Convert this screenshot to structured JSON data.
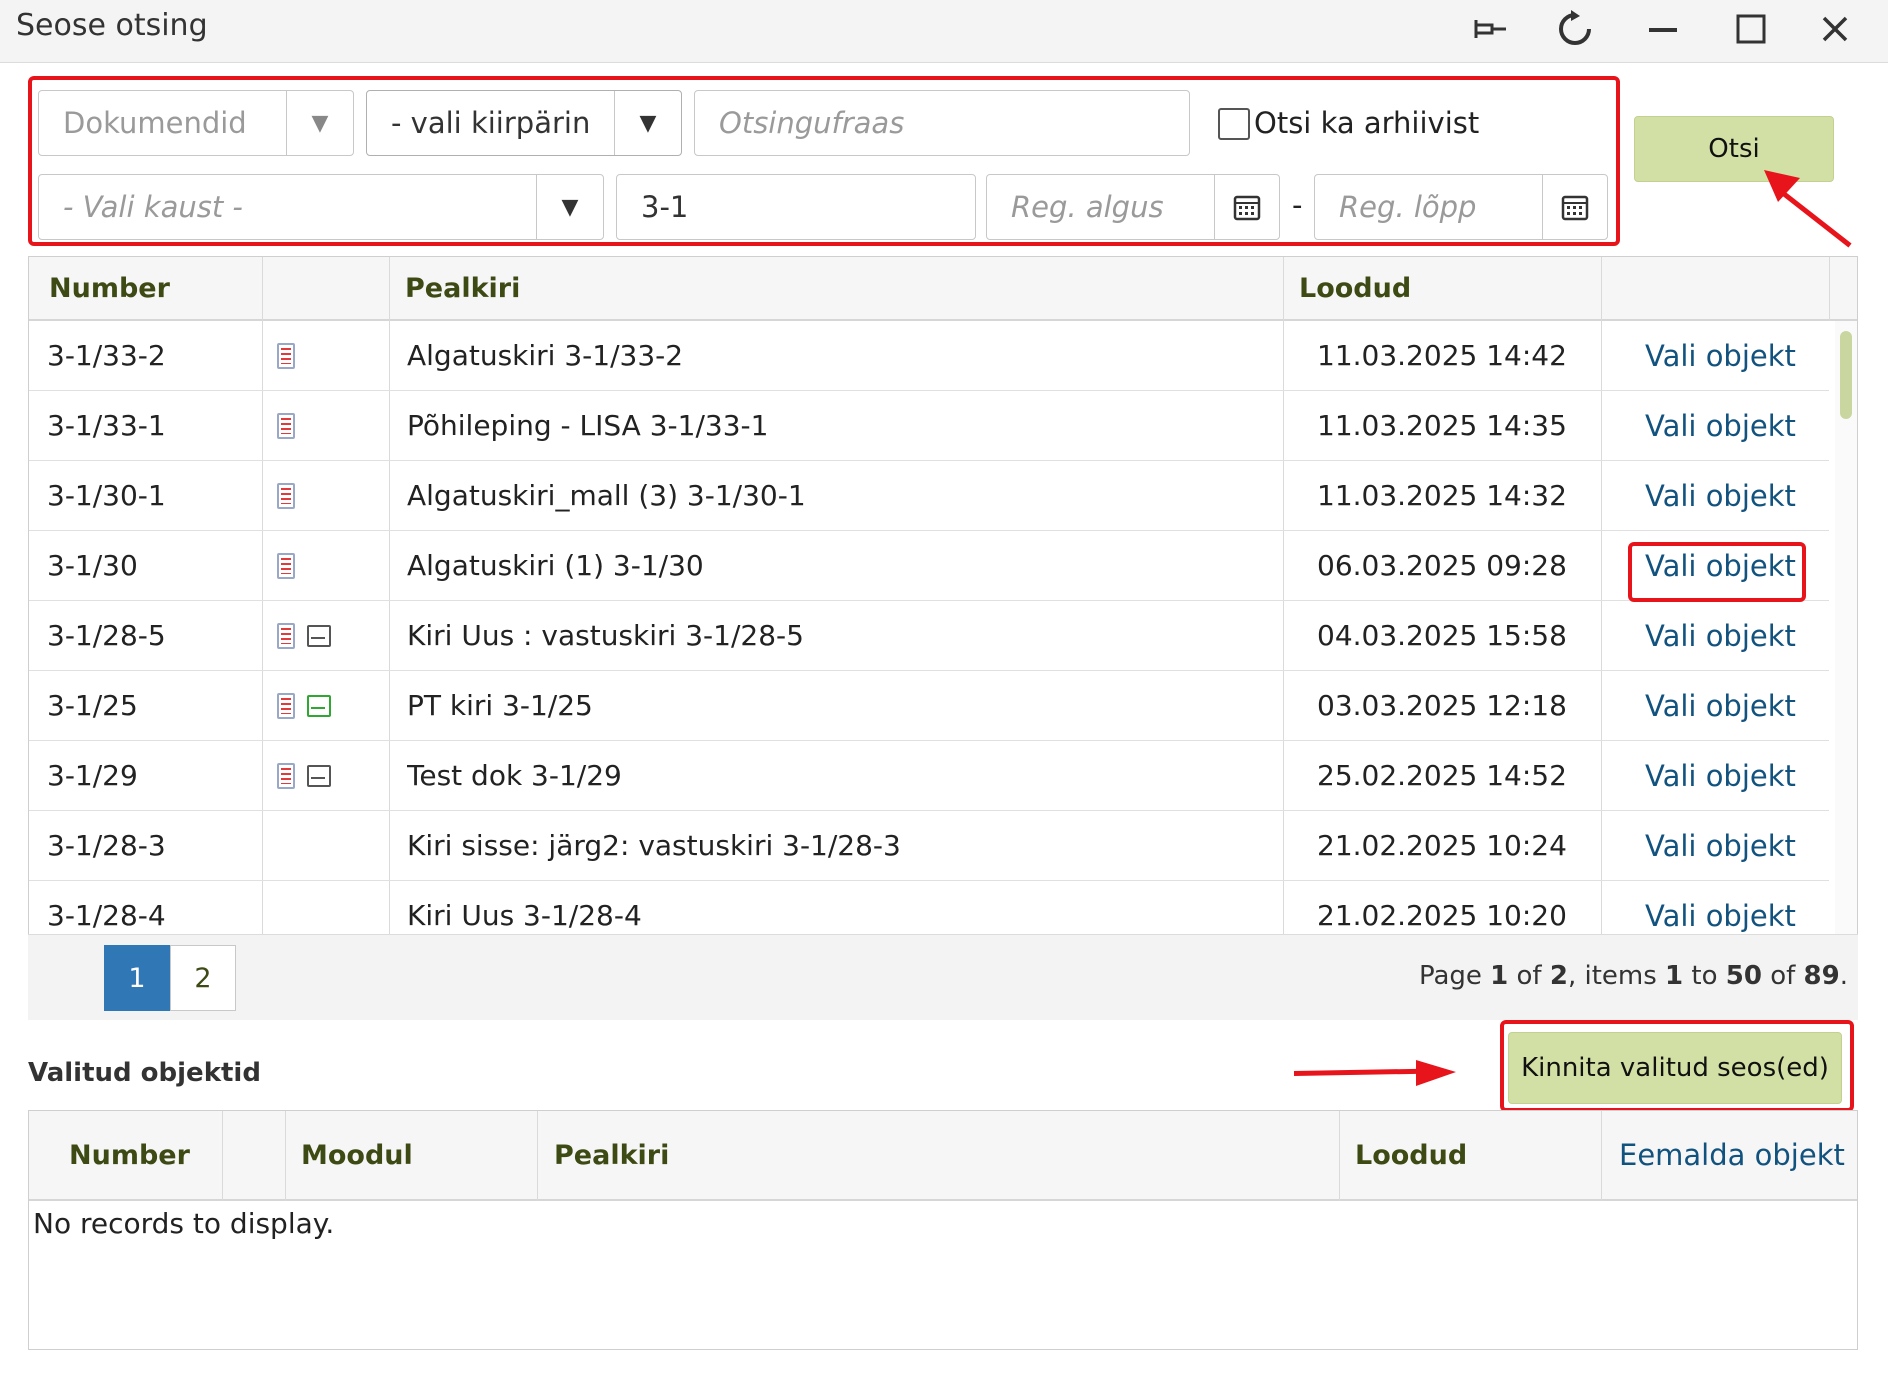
{
  "window": {
    "title": "Seose otsing",
    "buttons": [
      "pin-icon",
      "refresh-icon",
      "minimize-icon",
      "maximize-icon",
      "close-icon"
    ]
  },
  "search": {
    "module_select": "Dokumendid",
    "quick_query_select": "- vali kiirpäring",
    "phrase_placeholder": "Otsingufraas",
    "archive_checkbox_label": "Otsi ka arhiivist",
    "archive_checked": false,
    "folder_placeholder": "- Vali kaust -",
    "number_value": "3-1",
    "reg_start_placeholder": "Reg. algus",
    "reg_separator": "-",
    "reg_end_placeholder": "Reg. lõpp",
    "search_button": "Otsi"
  },
  "results": {
    "headers": {
      "number": "Number",
      "icons": "",
      "title": "Pealkiri",
      "created": "Loodud",
      "action": ""
    },
    "rows": [
      {
        "number": "3-1/33-2",
        "icons": [
          "document-icon"
        ],
        "title": "Algatuskiri 3-1/33-2",
        "created": "11.03.2025 14:42",
        "action": "Vali objekt"
      },
      {
        "number": "3-1/33-1",
        "icons": [
          "document-icon"
        ],
        "title": "Põhileping - LISA 3-1/33-1",
        "created": "11.03.2025 14:35",
        "action": "Vali objekt"
      },
      {
        "number": "3-1/30-1",
        "icons": [
          "document-icon"
        ],
        "title": "Algatuskiri_mall (3) 3-1/30-1",
        "created": "11.03.2025 14:32",
        "action": "Vali objekt"
      },
      {
        "number": "3-1/30",
        "icons": [
          "document-icon"
        ],
        "title": "Algatuskiri (1) 3-1/30",
        "created": "06.03.2025 09:28",
        "action": "Vali objekt"
      },
      {
        "number": "3-1/28-5",
        "icons": [
          "document-icon",
          "envelope-icon"
        ],
        "title": "Kiri Uus : vastuskiri 3-1/28-5",
        "created": "04.03.2025 15:58",
        "action": "Vali objekt"
      },
      {
        "number": "3-1/25",
        "icons": [
          "document-icon",
          "envelope-green-icon"
        ],
        "title": "PT kiri 3-1/25",
        "created": "03.03.2025 12:18",
        "action": "Vali objekt"
      },
      {
        "number": "3-1/29",
        "icons": [
          "document-icon",
          "envelope-icon"
        ],
        "title": "Test dok 3-1/29",
        "created": "25.02.2025 14:52",
        "action": "Vali objekt"
      },
      {
        "number": "3-1/28-3",
        "icons": [],
        "title": "Kiri sisse: järg2: vastuskiri 3-1/28-3",
        "created": "21.02.2025 10:24",
        "action": "Vali objekt"
      },
      {
        "number": "3-1/28-4",
        "icons": [],
        "title": "Kiri Uus 3-1/28-4",
        "created": "21.02.2025 10:20",
        "action": "Vali objekt"
      }
    ],
    "pager": {
      "pages": [
        "1",
        "2"
      ],
      "current_page": "1",
      "info": {
        "p1": "Page ",
        "page": "1",
        "p2": " of ",
        "pages": "2",
        "p3": ", items ",
        "from": "1",
        "p4": " to ",
        "to": "50",
        "p5": " of ",
        "total": "89",
        "p6": "."
      }
    }
  },
  "selected": {
    "heading": "Valitud objektid",
    "confirm_button": "Kinnita valitud seos(ed)",
    "headers": {
      "number": "Number",
      "icons": "",
      "module": "Moodul",
      "title": "Pealkiri",
      "created": "Loodud",
      "remove": "Eemalda objekt"
    },
    "empty_text": "No records to display."
  },
  "colors": {
    "accent_green": "#d2e0a6",
    "header_text": "#3d4a14",
    "link": "#12527e",
    "highlight_red": "#e8141c",
    "pager_active": "#2f77b5"
  }
}
